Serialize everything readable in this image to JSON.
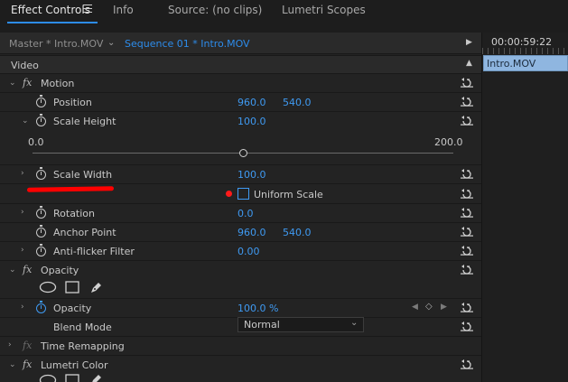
{
  "tabs": [
    {
      "label": "Effect Controls"
    },
    {
      "label": "Info"
    },
    {
      "label": "Source: (no clips)"
    },
    {
      "label": "Lumetri Scopes"
    }
  ],
  "header": {
    "master": "Master * Intro.MOV",
    "sequence": "Sequence 01 * Intro.MOV"
  },
  "timeline": {
    "timecode": "00:00:59:22",
    "clip": "Intro.MOV"
  },
  "video_section": "Video",
  "motion": {
    "label": "Motion",
    "position": {
      "label": "Position",
      "x": "960.0",
      "y": "540.0"
    },
    "scale_height": {
      "label": "Scale Height",
      "value": "100.0",
      "min": "0.0",
      "max": "200.0"
    },
    "scale_width": {
      "label": "Scale Width",
      "value": "100.0"
    },
    "uniform_scale": {
      "label": "Uniform Scale"
    },
    "rotation": {
      "label": "Rotation",
      "value": "0.0"
    },
    "anchor_point": {
      "label": "Anchor Point",
      "x": "960.0",
      "y": "540.0"
    },
    "anti_flicker": {
      "label": "Anti-flicker Filter",
      "value": "0.00"
    }
  },
  "opacity": {
    "label": "Opacity",
    "opacity_prop": {
      "label": "Opacity",
      "value": "100.0 %"
    },
    "blend_mode": {
      "label": "Blend Mode",
      "value": "Normal"
    }
  },
  "time_remapping": {
    "label": "Time Remapping"
  },
  "lumetri": {
    "label": "Lumetri Color"
  },
  "colors": {
    "accent": "#2d8ceb",
    "value_blue": "#3f9af2",
    "annotation_red": "#ff0000",
    "clip": "#8fb6e0"
  }
}
